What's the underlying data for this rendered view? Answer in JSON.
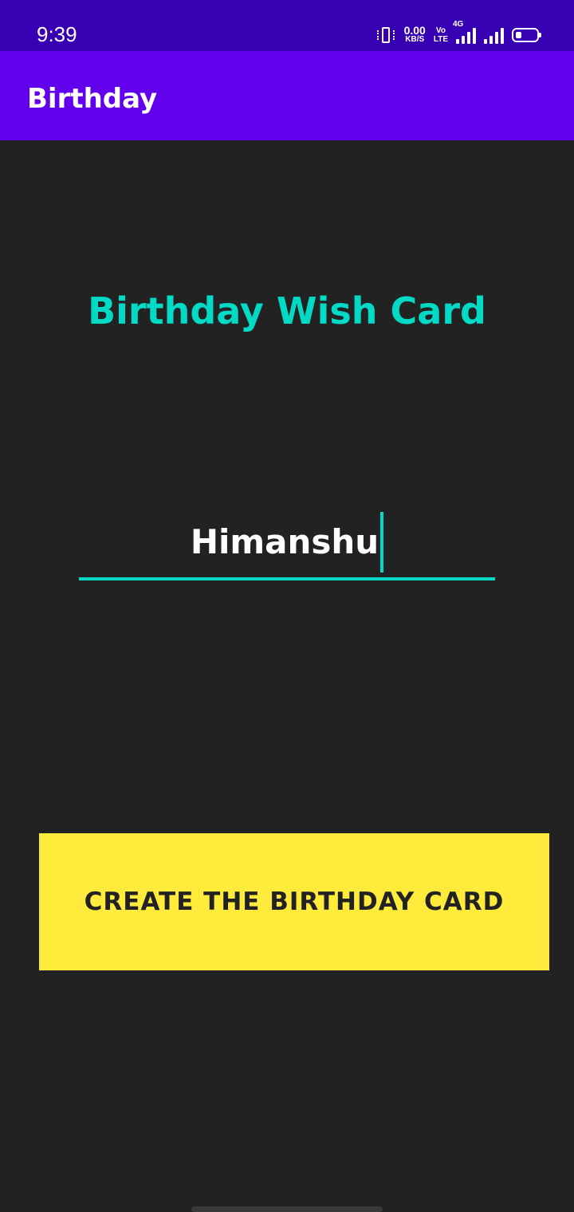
{
  "status_bar": {
    "time": "9:39",
    "net_speed_value": "0.00",
    "net_speed_unit": "KB/S",
    "volte_top": "Vo",
    "volte_bottom": "LTE",
    "network_type": "4G"
  },
  "app_bar": {
    "title": "Birthday"
  },
  "main": {
    "heading": "Birthday Wish Card",
    "name_input": {
      "value": "Himanshu"
    },
    "create_button_label": "CREATE THE BIRTHDAY CARD"
  },
  "colors": {
    "status_bar": "#3700b3",
    "app_bar": "#6200ee",
    "background": "#222222",
    "accent": "#03dac5",
    "button": "#ffeb3b"
  }
}
